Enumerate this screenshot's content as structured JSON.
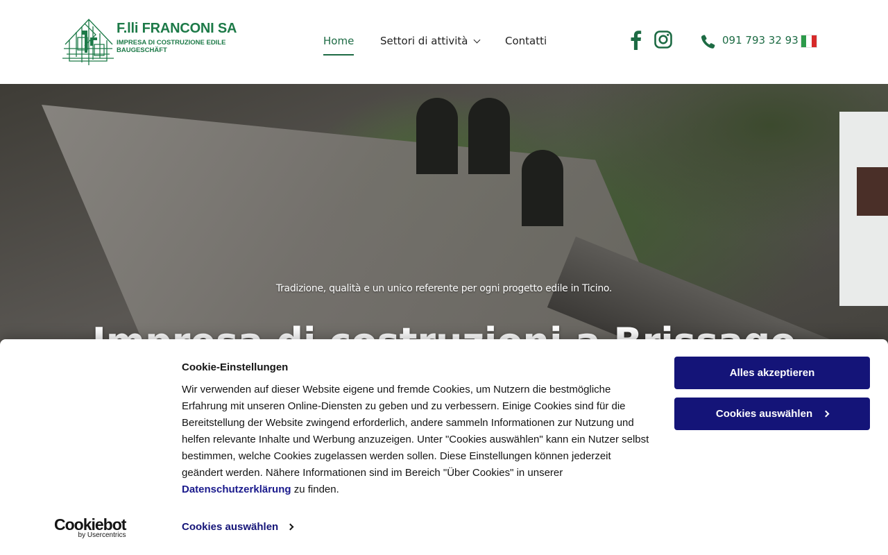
{
  "brand": {
    "name": "F.lli FRANCONI SA",
    "subtitle_line1": "IMPRESA DI COSTRUZIONE EDILE",
    "subtitle_line2": "BAUGESCHÄFT",
    "color": "#1d7a48"
  },
  "nav": {
    "items": [
      {
        "label": "Home",
        "active": true
      },
      {
        "label": "Settori di attività",
        "has_dropdown": true
      },
      {
        "label": "Contatti"
      }
    ]
  },
  "header_contact": {
    "social": [
      "facebook-icon",
      "instagram-icon"
    ],
    "phone": "091 793 32 93",
    "language_flag": "italy-flag"
  },
  "hero": {
    "tagline": "Tradizione, qualità e un unico referente per ogni progetto edile in Ticino.",
    "heading": "Impresa di costruzioni a Brissago"
  },
  "cookie_banner": {
    "title": "Cookie-Einstellungen",
    "text_before_link": "Wir verwenden auf dieser Website eigene und fremde Cookies, um Nutzern die bestmögliche Erfahrung mit unseren Online-Diensten zu geben und zu verbessern. Einige Cookies sind für die Bereitstellung der Website zwingend erforderlich, andere sammeln Informationen zur Nutzung und helfen relevante Inhalte und Werbung anzuzeigen. Unter \"Cookies auswählen\" kann ein Nutzer selbst bestimmen, welche Cookies zugelassen werden sollen. Diese Einstellungen können jederzeit geändert werden. Nähere Informationen sind im Bereich \"Über Cookies\" in unserer",
    "link_label": "Datenschutzerklärung",
    "text_after_link": "zu finden.",
    "accept_button": "Alles akzeptieren",
    "select_button": "Cookies auswählen",
    "select_link": "Cookies auswählen",
    "provider_name": "Cookiebot",
    "provider_by": "by Usercentrics",
    "button_color": "#141478"
  },
  "colors": {
    "accent_green": "#1d6b44",
    "flag": [
      "#2c9a4a",
      "#ffffff",
      "#d62a2a"
    ]
  }
}
